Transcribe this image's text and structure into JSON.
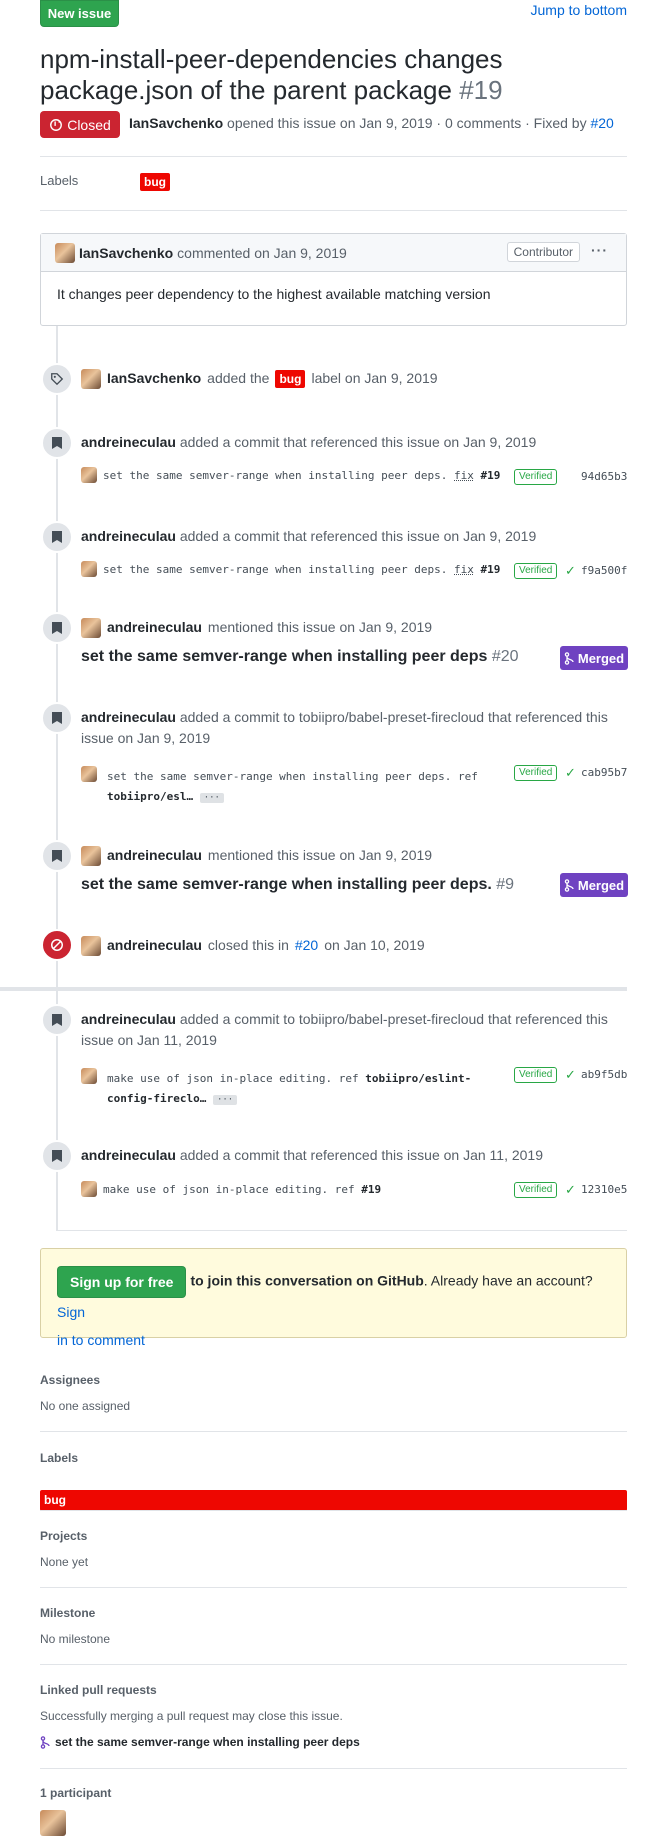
{
  "header": {
    "new_issue_label": "New issue",
    "jump_label": "Jump to bottom"
  },
  "issue": {
    "title": "npm-install-peer-dependencies changes package.json of the parent package",
    "number": "#19",
    "state": "Closed",
    "author": "IanSavchenko",
    "meta_text": "opened this issue on Jan 9, 2019 · 0 comments · Fixed by",
    "fixed_by": "#20"
  },
  "labels_section": {
    "title": "Labels",
    "label": "bug"
  },
  "comment": {
    "author": "IanSavchenko",
    "action": "commented on Jan 9, 2019",
    "badge": "Contributor",
    "menu": "···",
    "body": "It changes peer dependency to the highest available matching version"
  },
  "events": {
    "label_event": {
      "actor": "IanSavchenko",
      "pre": "added the",
      "label": "bug",
      "post": "label on Jan 9, 2019"
    },
    "commit1": {
      "actor": "andreineculau",
      "text": "added a commit that referenced this issue on Jan 9, 2019",
      "message": "set the same semver-range when installing peer deps.",
      "fix": "fix",
      "ref": "#19",
      "verified": "Verified",
      "sha": "94d65b3"
    },
    "commit2": {
      "actor": "andreineculau",
      "text": "added a commit that referenced this issue on Jan 9, 2019",
      "message": "set the same semver-range when installing peer deps.",
      "fix": "fix",
      "ref": "#19",
      "verified": "Verified",
      "sha": "f9a500f"
    },
    "mention1": {
      "actor": "andreineculau",
      "text": "mentioned this issue on Jan 9, 2019",
      "pr_title": "set the same semver-range when installing peer deps",
      "pr_num": "#20",
      "status": "Merged"
    },
    "commit3": {
      "actor": "andreineculau",
      "text1": "added a commit to tobiipro/babel-preset-firecloud that referenced this",
      "text2": "issue on Jan 9, 2019",
      "message": "set the same semver-range when installing peer deps. ref",
      "ref": "tobiipro/esl…",
      "more": "···",
      "verified": "Verified",
      "sha": "cab95b7"
    },
    "mention2": {
      "actor": "andreineculau",
      "text": "mentioned this issue on Jan 9, 2019",
      "pr_title": "set the same semver-range when installing peer deps.",
      "pr_num": "#9",
      "status": "Merged"
    },
    "closed": {
      "actor": "andreineculau",
      "pre": "closed this in",
      "ref": "#20",
      "post": "on Jan 10, 2019"
    },
    "commit4": {
      "actor": "andreineculau",
      "text1": "added a commit to tobiipro/babel-preset-firecloud that referenced this",
      "text2": "issue on Jan 11, 2019",
      "message": "make use of json in-place editing. ref",
      "ref1": "tobiipro/eslint-",
      "ref2": "config-fireclo…",
      "more": "···",
      "verified": "Verified",
      "sha": "ab9f5db"
    },
    "commit5": {
      "actor": "andreineculau",
      "text": "added a commit that referenced this issue on Jan 11, 2019",
      "message": "make use of json in-place editing. ref",
      "ref": "#19",
      "verified": "Verified",
      "sha": "12310e5"
    }
  },
  "signup": {
    "button": "Sign up for free",
    "bold": "to join this conversation on GitHub",
    "text": ". Already have an account?",
    "link1": "Sign",
    "link2": "in to comment"
  },
  "sidebar": {
    "assignees_title": "Assignees",
    "assignees_value": "No one assigned",
    "labels_title": "Labels",
    "labels_value": "bug",
    "projects_title": "Projects",
    "projects_value": "None yet",
    "milestone_title": "Milestone",
    "milestone_value": "No milestone",
    "linked_title": "Linked pull requests",
    "linked_desc": "Successfully merging a pull request may close this issue.",
    "linked_pr": "set the same semver-range when installing peer deps",
    "participants_title": "1 participant"
  },
  "colors": {
    "green": "#2ea44f",
    "closed_red": "#cb2431",
    "label_bug": "#ee0701",
    "merged_purple": "#6f42c1",
    "link_blue": "#0366d6"
  }
}
